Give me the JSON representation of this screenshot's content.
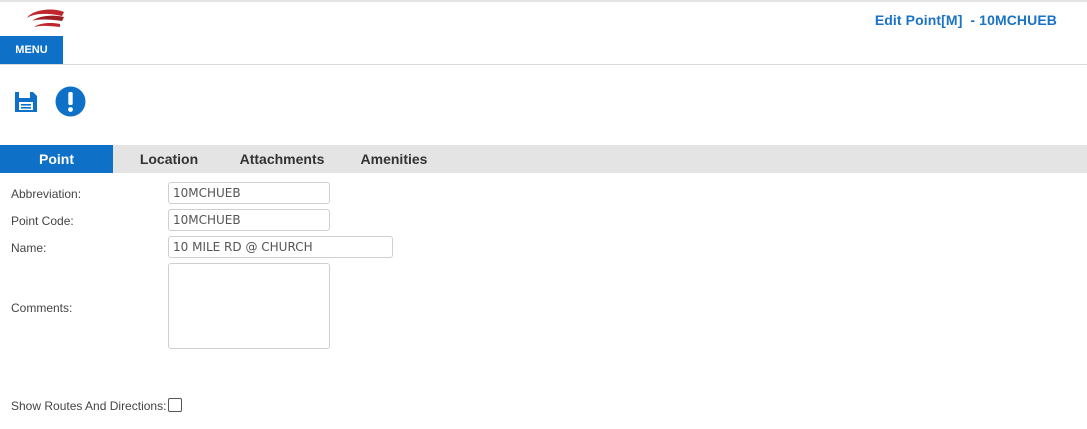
{
  "header": {
    "title": "Edit Point[M]  - 10MCHUEB",
    "menu_label": "MENU",
    "logo_name": "swoosh-logo"
  },
  "toolbar": {
    "save_icon": "save-icon",
    "alert_icon": "alert-icon"
  },
  "tabs": [
    {
      "label": "Point",
      "active": true
    },
    {
      "label": "Location",
      "active": false
    },
    {
      "label": "Attachments",
      "active": false
    },
    {
      "label": "Amenities",
      "active": false
    }
  ],
  "form": {
    "abbreviation": {
      "label": "Abbreviation:",
      "value": "10MCHUEB"
    },
    "point_code": {
      "label": "Point Code:",
      "value": "10MCHUEB"
    },
    "name": {
      "label": "Name:",
      "value": "10 MILE RD @ CHURCH"
    },
    "comments": {
      "label": "Comments:",
      "value": ""
    },
    "show_routes": {
      "label": "Show Routes And Directions:",
      "checked": false
    }
  },
  "colors": {
    "accent": "#0e70c6",
    "title": "#1a73c7",
    "logo_red": "#c0262d",
    "tabbar_bg": "#e4e4e4"
  }
}
